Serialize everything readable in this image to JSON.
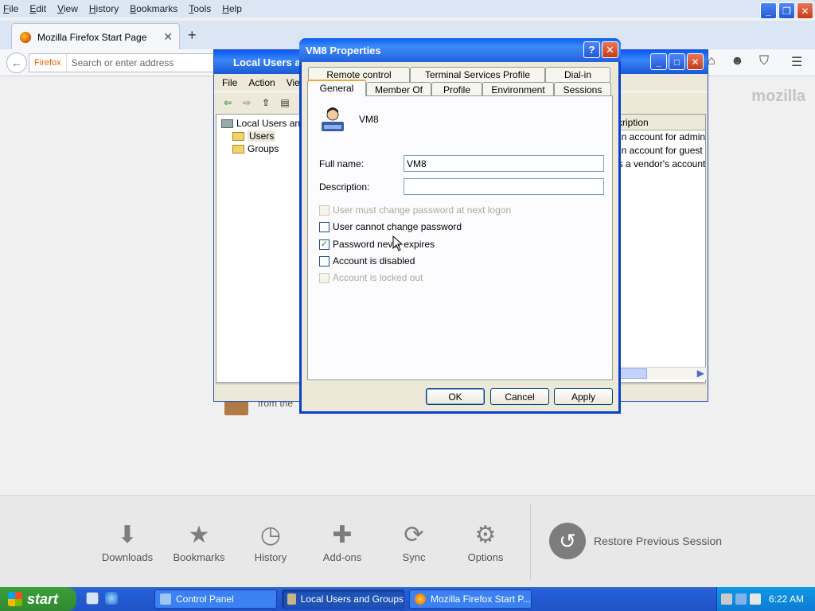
{
  "firefox": {
    "menu": [
      "File",
      "Edit",
      "View",
      "History",
      "Bookmarks",
      "Tools",
      "Help"
    ],
    "tab_title": "Mozilla Firefox Start Page",
    "url_brand": "Firefox",
    "url_placeholder": "Search or enter address",
    "logo": "mozilla",
    "launchers": [
      {
        "label": "Downloads",
        "icon": "download-icon"
      },
      {
        "label": "Bookmarks",
        "icon": "star-icon"
      },
      {
        "label": "History",
        "icon": "clock-icon"
      },
      {
        "label": "Add-ons",
        "icon": "puzzle-icon"
      },
      {
        "label": "Sync",
        "icon": "sync-icon"
      },
      {
        "label": "Options",
        "icon": "gear-icon"
      }
    ],
    "restore_label": "Restore Previous Session",
    "obscured_text": "from the"
  },
  "lusrmgr": {
    "title": "Local Users an",
    "menu": [
      "File",
      "Action",
      "View"
    ],
    "tree_root": "Local Users and",
    "tree_users": "Users",
    "tree_groups": "Groups",
    "col_header": "cription",
    "rows": [
      "-in account for adminis",
      "-in account for guest a",
      "is a vendor's account"
    ]
  },
  "dialog": {
    "title": "VM8 Properties",
    "tabs_row1": [
      "Remote control",
      "Terminal Services Profile",
      "Dial-in"
    ],
    "tabs_row2": [
      "General",
      "Member Of",
      "Profile",
      "Environment",
      "Sessions"
    ],
    "username": "VM8",
    "full_name_label": "Full name:",
    "full_name_value": "VM8",
    "description_label": "Description:",
    "description_value": "",
    "checkboxes": [
      {
        "label": "User must change password at next logon",
        "checked": false,
        "disabled": true
      },
      {
        "label": "User cannot change password",
        "checked": false,
        "disabled": false
      },
      {
        "label": "Password never expires",
        "checked": true,
        "disabled": false
      },
      {
        "label": "Account is disabled",
        "checked": false,
        "disabled": false
      },
      {
        "label": "Account is locked out",
        "checked": false,
        "disabled": true
      }
    ],
    "buttons": {
      "ok": "OK",
      "cancel": "Cancel",
      "apply": "Apply"
    }
  },
  "taskbar": {
    "start": "start",
    "tasks": [
      "Control Panel",
      "Local Users and Groups",
      "Mozilla Firefox Start P..."
    ],
    "clock": "6:22 AM"
  }
}
